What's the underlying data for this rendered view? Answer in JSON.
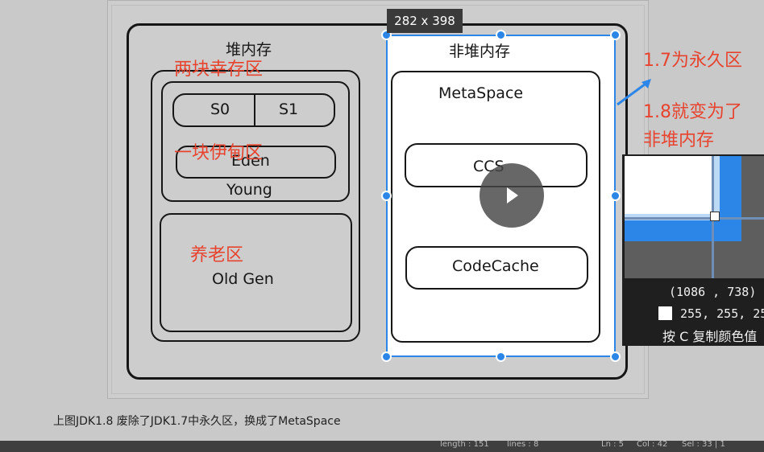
{
  "diagram": {
    "heap_label": "堆内存",
    "non_heap_label": "非堆内存",
    "s0": "S0",
    "s1": "S1",
    "eden": "Eden",
    "young": "Young",
    "old_gen": "Old Gen",
    "metaspace": "MetaSpace",
    "ccs": "CCS",
    "codecache": "CodeCache"
  },
  "annotations": {
    "two_survivor": "两块幸存区",
    "one_eden": "一块伊甸区",
    "old_area": "养老区",
    "permgen_note_1": "1.7为永久区",
    "permgen_note_2a": "1.8就变为了",
    "permgen_note_2b": "非堆内存"
  },
  "selection": {
    "size": "282 x 398",
    "accent_color": "#2b86e8"
  },
  "magnifier": {
    "coords": "(1086 , 738)",
    "rgb": "255, 255, 25",
    "hint": "按 C 复制颜色值"
  },
  "caption": "上图JDK1.8 废除了JDK1.7中永久区，换成了MetaSpace",
  "status_bar": {
    "length": "length : 151",
    "lines": "lines : 8",
    "ln": "Ln : 5",
    "col": "Col : 42",
    "sel": "Sel : 33 | 1"
  },
  "player": {
    "play_icon": "play-icon"
  }
}
